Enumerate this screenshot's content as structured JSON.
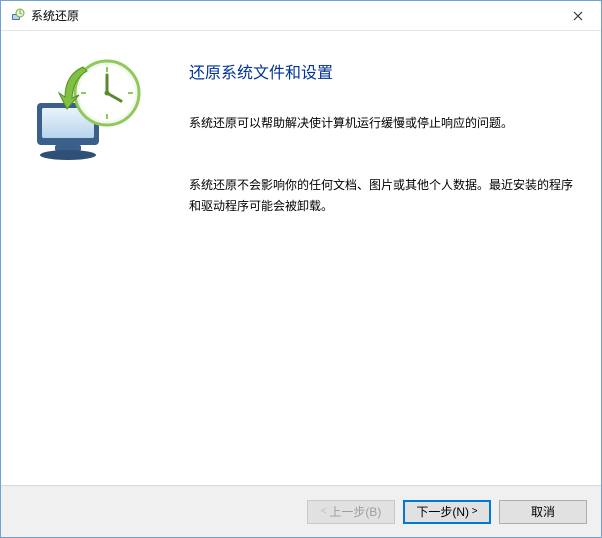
{
  "titlebar": {
    "title": "系统还原"
  },
  "main": {
    "heading": "还原系统文件和设置",
    "paragraph1": "系统还原可以帮助解决使计算机运行缓慢或停止响应的问题。",
    "paragraph2": "系统还原不会影响你的任何文档、图片或其他个人数据。最近安装的程序和驱动程序可能会被卸载。"
  },
  "footer": {
    "back_label": "上一步(B)",
    "next_label": "下一步(N)",
    "cancel_label": "取消"
  }
}
